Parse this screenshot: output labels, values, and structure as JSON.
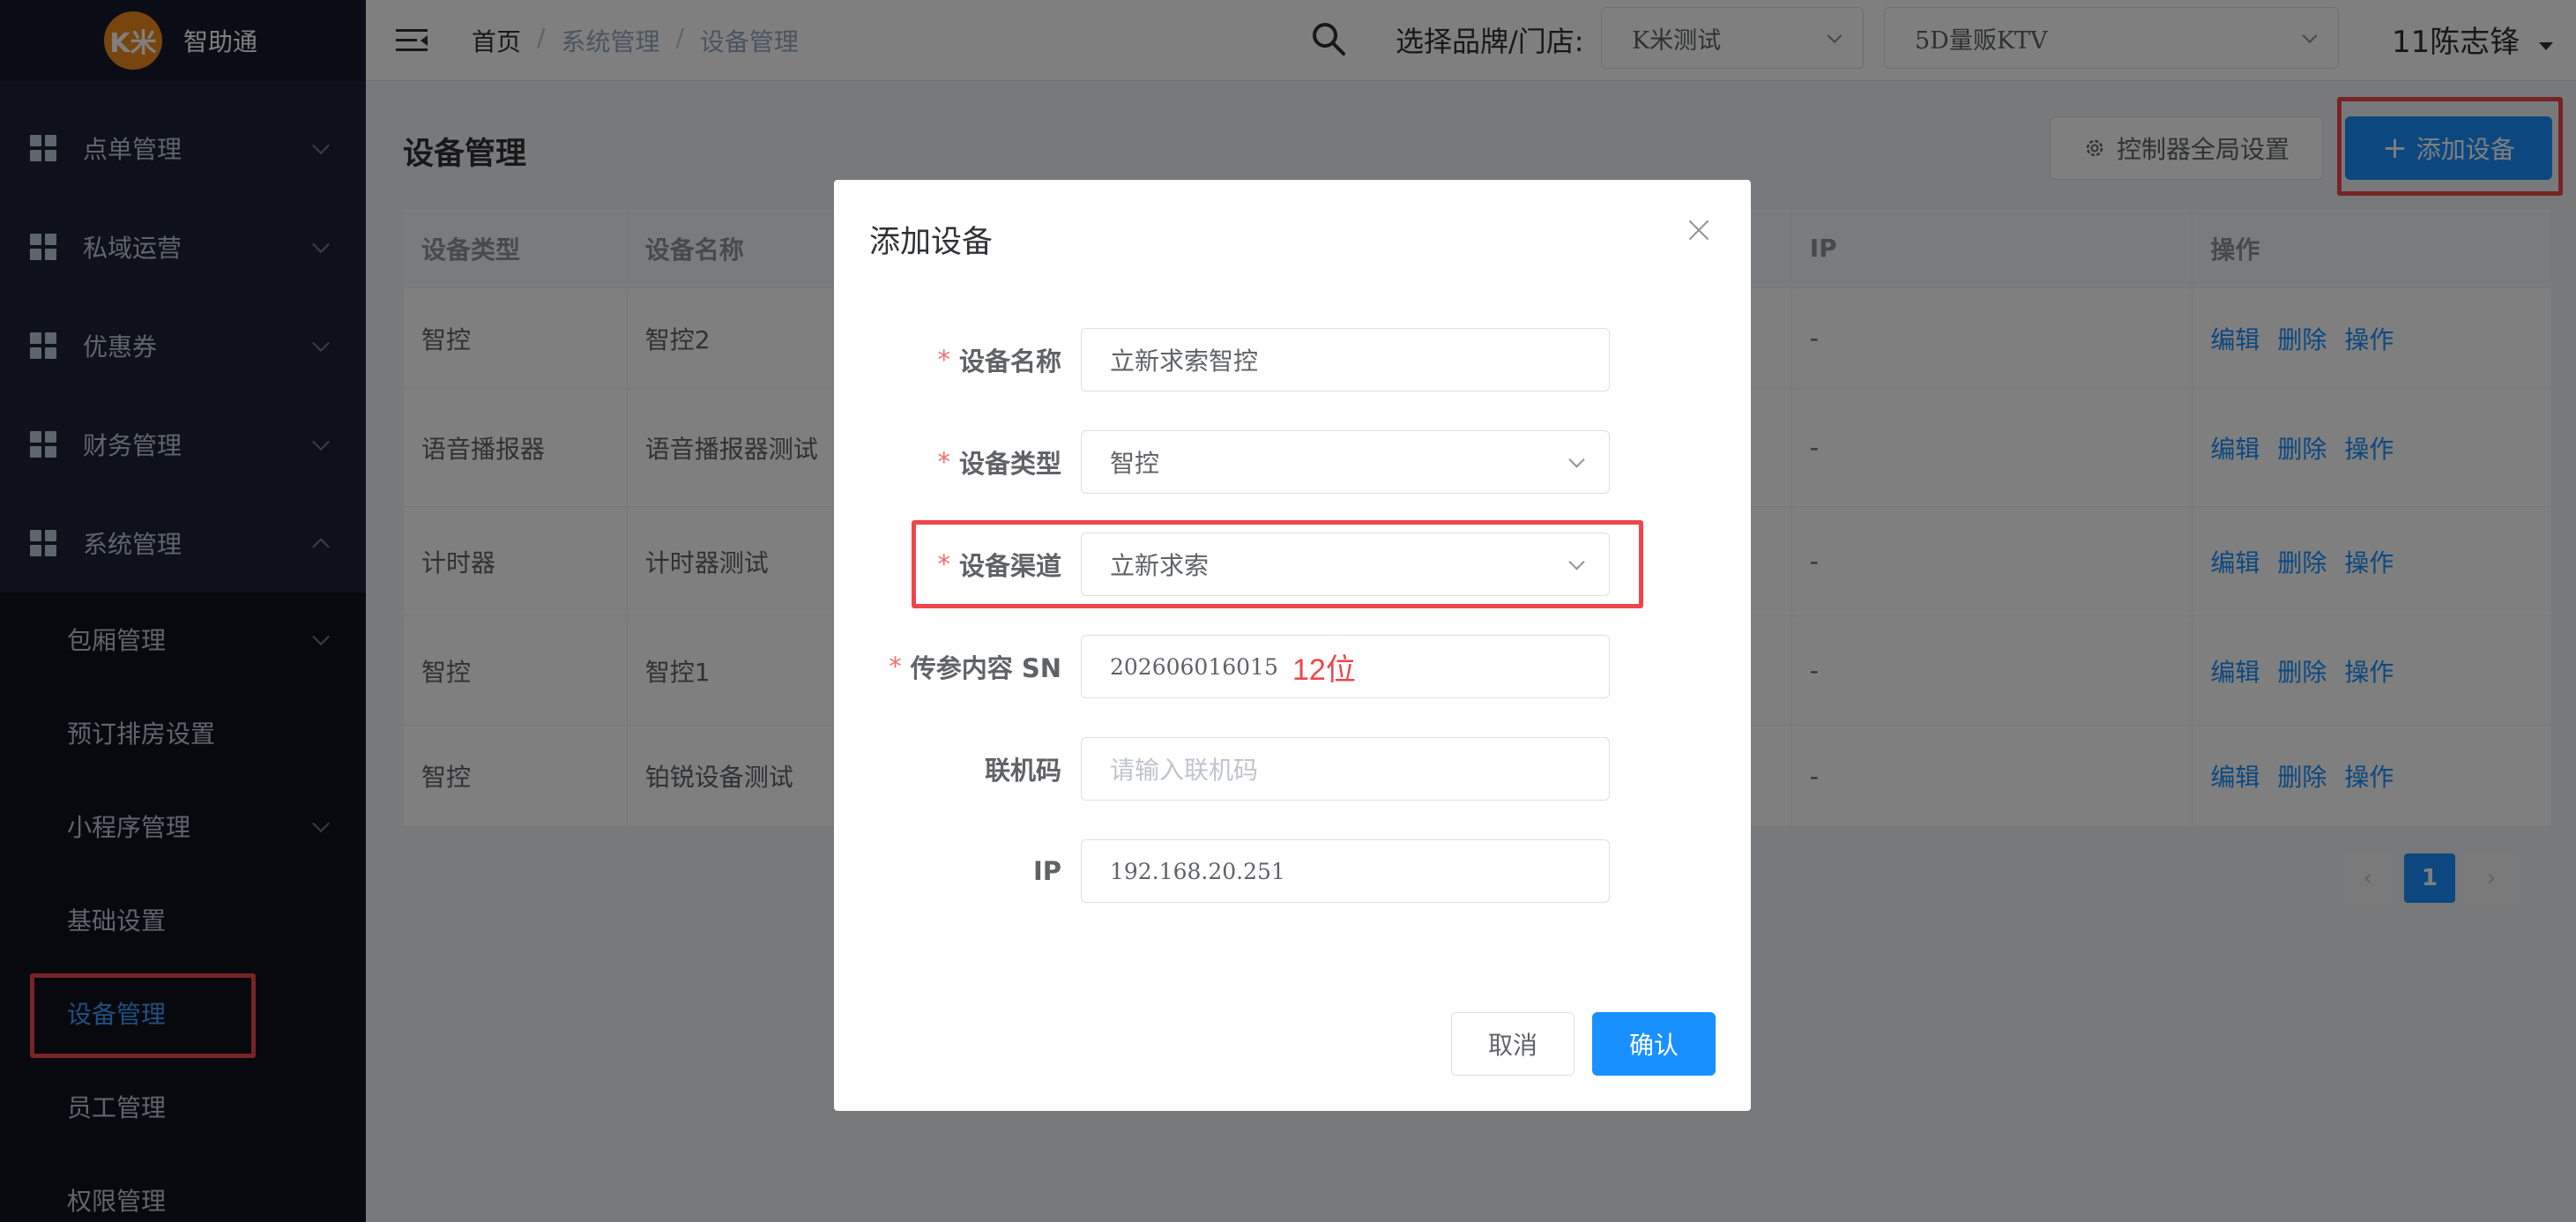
{
  "app": {
    "logo_badge": "K米",
    "logo_text": "智助通"
  },
  "sidebar": {
    "items": [
      {
        "label": "点单管理"
      },
      {
        "label": "私域运营"
      },
      {
        "label": "优惠券"
      },
      {
        "label": "财务管理"
      },
      {
        "label": "系统管理"
      }
    ],
    "subitems": [
      {
        "label": "包厢管理"
      },
      {
        "label": "预订排房设置"
      },
      {
        "label": "小程序管理"
      },
      {
        "label": "基础设置"
      },
      {
        "label": "设备管理"
      },
      {
        "label": "员工管理"
      },
      {
        "label": "权限管理"
      }
    ]
  },
  "header": {
    "breadcrumb": [
      "首页",
      "系统管理",
      "设备管理"
    ],
    "brand_label": "选择品牌/门店:",
    "brand_select": "K米测试",
    "store_select": "5D量贩KTV",
    "user": "11陈志锋"
  },
  "main": {
    "title": "设备管理",
    "btn_global": "控制器全局设置",
    "btn_add": "添加设备",
    "table": {
      "headers": [
        "设备类型",
        "设备名称",
        "",
        "IP",
        "操作"
      ],
      "rows": [
        {
          "type": "智控",
          "name": "智控2",
          "ip": "-"
        },
        {
          "type": "语音播报器",
          "name": "语音播报器测试",
          "ip": "-"
        },
        {
          "type": "计时器",
          "name": "计时器测试",
          "ip": "-"
        },
        {
          "type": "智控",
          "name": "智控1",
          "ip": "-"
        },
        {
          "type": "智控",
          "name": "铂锐设备测试",
          "ip": "-"
        }
      ],
      "actions": [
        "编辑",
        "删除",
        "操作"
      ]
    },
    "pagination": {
      "current": "1"
    }
  },
  "dialog": {
    "title": "添加设备",
    "fields": {
      "name": {
        "label": "设备名称",
        "value": "立新求索智控"
      },
      "type": {
        "label": "设备类型",
        "value": "智控"
      },
      "channel": {
        "label": "设备渠道",
        "value": "立新求索"
      },
      "sn": {
        "label": "传参内容 SN",
        "value": "202606016015",
        "note": "12位"
      },
      "code": {
        "label": "联机码",
        "placeholder": "请输入联机码"
      },
      "ip": {
        "label": "IP",
        "value": "192.168.20.251"
      }
    },
    "cancel": "取消",
    "confirm": "确认"
  },
  "colors": {
    "accent": "#1890ff",
    "sidebar": "#1d2336",
    "highlight": "#f0464b",
    "required": "#f56c6c"
  }
}
